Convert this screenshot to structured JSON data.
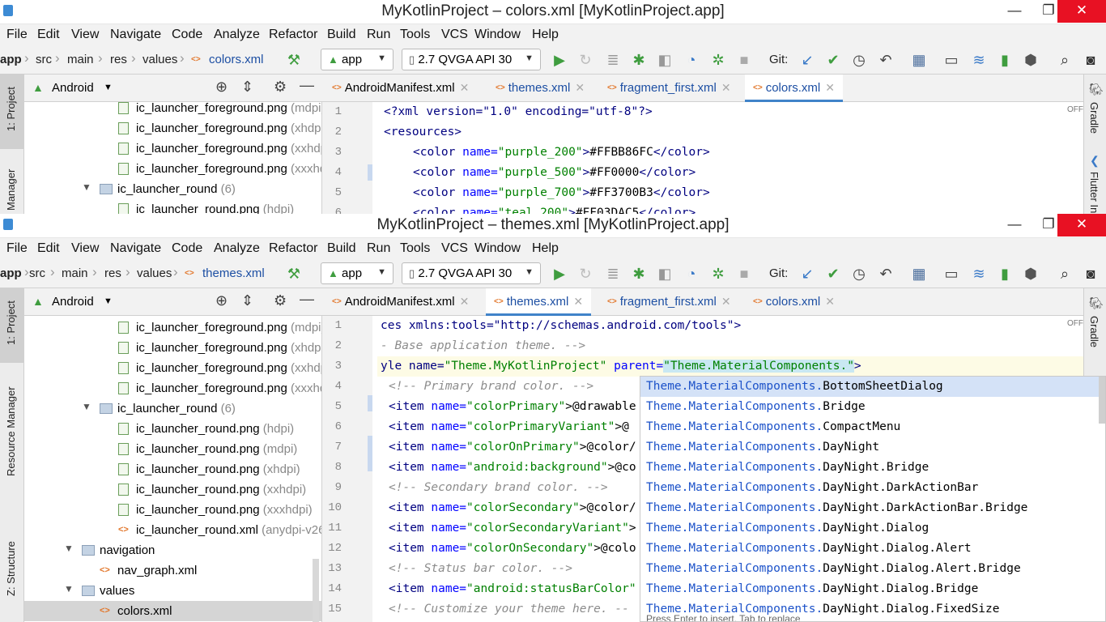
{
  "windows": [
    {
      "title": "MyKotlinProject – colors.xml [MyKotlinProject.app]",
      "menu": [
        "File",
        "Edit",
        "View",
        "Navigate",
        "Code",
        "Analyze",
        "Refactor",
        "Build",
        "Run",
        "Tools",
        "VCS",
        "Window",
        "Help"
      ],
      "breadcrumb": [
        "app",
        "src",
        "main",
        "res",
        "values",
        "colors.xml"
      ],
      "run_config": "app",
      "device": "2.7  QVGA API 30",
      "git_label": "Git:",
      "panel_title": "Android",
      "left_tabs": [
        "1: Project",
        "Manager"
      ],
      "right_tabs": [
        "Gradle",
        "Flutter In"
      ],
      "tree": [
        {
          "label": "ic_launcher_foreground.png",
          "hint": " (mdpi)",
          "type": "png"
        },
        {
          "label": "ic_launcher_foreground.png",
          "hint": " (xhdpi)",
          "type": "png"
        },
        {
          "label": "ic_launcher_foreground.png",
          "hint": " (xxhdpi)",
          "type": "png"
        },
        {
          "label": "ic_launcher_foreground.png",
          "hint": " (xxxhdpi)",
          "type": "png"
        },
        {
          "label": "ic_launcher_round",
          "hint": " (6)",
          "type": "folder"
        },
        {
          "label": "ic_launcher_round.png",
          "hint": " (hdpi)",
          "type": "png"
        }
      ],
      "tabs": [
        {
          "name": "AndroidManifest.xml"
        },
        {
          "name": "themes.xml"
        },
        {
          "name": "fragment_first.xml"
        },
        {
          "name": "colors.xml"
        }
      ],
      "status_off": "OFF",
      "line_numbers": [
        "1",
        "2",
        "3",
        "4",
        "5",
        "6"
      ],
      "code": {
        "l1": "<?xml version=\"1.0\" encoding=\"utf-8\"?>",
        "l2": "<resources>",
        "l3_name": "\"purple_200\"",
        "l3_val": "#FFBB86FC",
        "l4_name": "\"purple_500\"",
        "l4_val": "#FF0000",
        "l5_name": "\"purple_700\"",
        "l5_val": "#FF3700B3",
        "l6_name": "\"teal_200\"",
        "l6_val": "#FF03DAC5"
      }
    },
    {
      "title": "MyKotlinProject – themes.xml [MyKotlinProject.app]",
      "breadcrumb": [
        "app",
        "src",
        "main",
        "res",
        "values",
        "themes.xml"
      ],
      "left_tabs": [
        "1: Project",
        "Resource Manager",
        "Z: Structure"
      ],
      "right_tabs": [
        "Gradle"
      ],
      "tree": [
        {
          "label": "ic_launcher_foreground.png",
          "hint": " (mdpi)",
          "type": "png"
        },
        {
          "label": "ic_launcher_foreground.png",
          "hint": " (xhdpi)",
          "type": "png"
        },
        {
          "label": "ic_launcher_foreground.png",
          "hint": " (xxhdpi)",
          "type": "png"
        },
        {
          "label": "ic_launcher_foreground.png",
          "hint": " (xxxhdpi)",
          "type": "png"
        },
        {
          "label": "ic_launcher_round",
          "hint": " (6)",
          "type": "folder"
        },
        {
          "label": "ic_launcher_round.png",
          "hint": " (hdpi)",
          "type": "png"
        },
        {
          "label": "ic_launcher_round.png",
          "hint": " (mdpi)",
          "type": "png"
        },
        {
          "label": "ic_launcher_round.png",
          "hint": " (xhdpi)",
          "type": "png"
        },
        {
          "label": "ic_launcher_round.png",
          "hint": " (xxhdpi)",
          "type": "png"
        },
        {
          "label": "ic_launcher_round.png",
          "hint": " (xxxhdpi)",
          "type": "png"
        },
        {
          "label": "ic_launcher_round.xml",
          "hint": " (anydpi-v26)",
          "type": "xml"
        },
        {
          "label": "navigation",
          "hint": "",
          "type": "folder"
        },
        {
          "label": "nav_graph.xml",
          "hint": "",
          "type": "xml"
        },
        {
          "label": "values",
          "hint": "",
          "type": "folder"
        },
        {
          "label": "colors.xml",
          "hint": "",
          "type": "xml"
        }
      ],
      "line_numbers": [
        "1",
        "2",
        "3",
        "4",
        "5",
        "6",
        "7",
        "8",
        "9",
        "10",
        "11",
        "12",
        "13",
        "14",
        "15"
      ],
      "code": {
        "l1": "ces xmlns:tools=\"http://schemas.android.com/tools\">",
        "l2": "- Base application theme. -->",
        "l3_a": "yle name=",
        "l3_b": "\"Theme.MyKotlinProject\"",
        "l3_c": " parent=",
        "l3_d": "\"Theme.MaterialComponents.\"",
        "l4": "<!-- Primary brand color. -->",
        "l5_n": "\"colorPrimary\"",
        "l5_v": ">@drawable",
        "l6_n": "\"colorPrimaryVariant\"",
        "l6_v": ">@",
        "l7_n": "\"colorOnPrimary\"",
        "l7_v": ">@color/",
        "l8_n": "\"android:background\"",
        "l8_v": ">@co",
        "l9": "<!-- Secondary brand color. -->",
        "l10_n": "\"colorSecondary\"",
        "l10_v": ">@color/",
        "l11_n": "\"colorSecondaryVariant\"",
        "l11_v": ">",
        "l12_n": "\"colorOnSecondary\"",
        "l12_v": ">@colo",
        "l13": "<!-- Status bar color. -->",
        "l14_n": "\"android:statusBarColor\"",
        "l14_v": "",
        "l15": "<!-- Customize your theme here. --"
      },
      "completion_prefix": "Theme.MaterialComponents.",
      "completion": [
        "BottomSheetDialog",
        "Bridge",
        "CompactMenu",
        "DayNight",
        "DayNight.Bridge",
        "DayNight.DarkActionBar",
        "DayNight.DarkActionBar.Bridge",
        "DayNight.Dialog",
        "DayNight.Dialog.Alert",
        "DayNight.Dialog.Alert.Bridge",
        "DayNight.Dialog.Bridge",
        "DayNight.Dialog.FixedSize"
      ],
      "completion_footer": "Press Enter to insert, Tab to replace"
    }
  ],
  "colors": {
    "accent": "#4083c9",
    "close": "#e81123",
    "run": "#3f9d3f"
  }
}
